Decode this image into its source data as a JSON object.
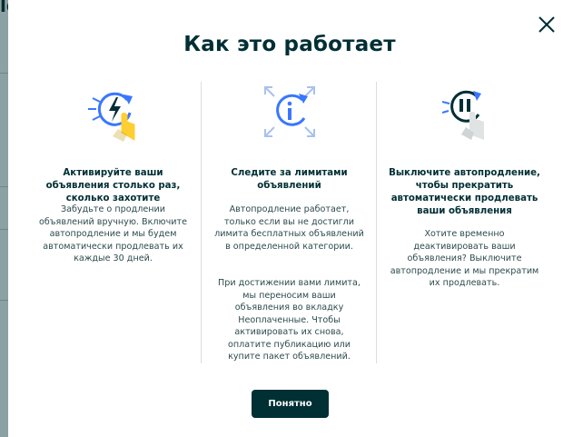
{
  "modal": {
    "title": "Как это работает",
    "columns": [
      {
        "heading": "Активируйте ваши объявления столько раз, сколько захотите",
        "body": "Забудьте о продлении объявлений вручную. Включите автопродление и мы будем автоматически продлевать их каждые 30 дней.",
        "icon": "refresh-lightning-hand-icon"
      },
      {
        "heading": "Следите за лимитами объявлений",
        "body": "Автопродление работает, только если вы не достигли лимита бесплатных объявлений в определенной категории.",
        "body2": "При достижении вами лимита, мы переносим ваши объявления во вкладку Неоплаченные. Чтобы активировать их снова, оплатите публикацию или купите пакет объявлений.",
        "icon": "info-expand-icon"
      },
      {
        "heading": "Выключите автопродление, чтобы прекратить автоматически продлевать ваши объявления",
        "body": "Хотите временно деактивировать ваши объявления? Выключите автопродление и мы прекратим их продлевать.",
        "icon": "pause-hand-icon"
      }
    ],
    "ok_label": "Понятно"
  },
  "colors": {
    "primary": "#002f34",
    "accent_blue": "#3a77ff",
    "accent_yellow": "#ffce32",
    "divider": "#d8dfe0"
  }
}
